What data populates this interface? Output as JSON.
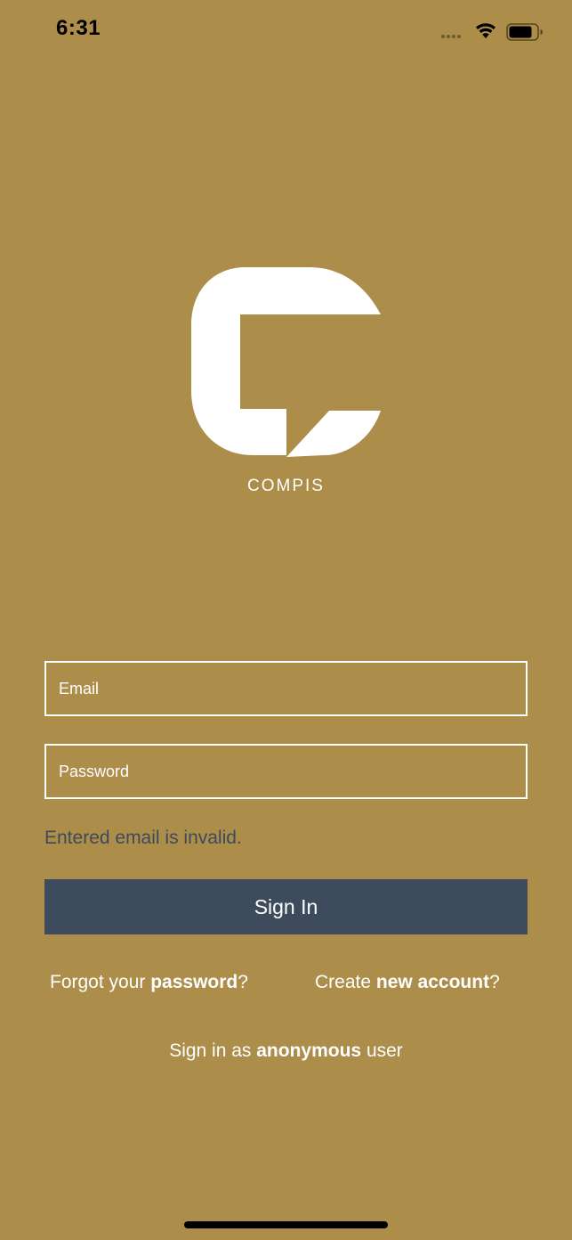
{
  "status_bar": {
    "time": "6:31",
    "icons": [
      "signal-dots-icon",
      "wifi-icon",
      "battery-icon"
    ]
  },
  "logo": {
    "icon": "compis-logo-icon",
    "brand_name": "COMPIS"
  },
  "form": {
    "email_placeholder": "Email",
    "email_value": "",
    "password_placeholder": "Password",
    "password_value": "",
    "error_message": "Entered email is invalid.",
    "signin_label": "Sign In"
  },
  "links": {
    "forgot_prefix": "Forgot your ",
    "forgot_bold": "password",
    "forgot_suffix": "?",
    "create_prefix": "Create ",
    "create_bold": "new account",
    "create_suffix": "?",
    "anon_prefix": "Sign in as ",
    "anon_bold": "anonymous",
    "anon_suffix": " user"
  },
  "colors": {
    "background": "#ad8d4a",
    "button": "#3d4b5c",
    "error_text": "#3d4a5c",
    "foreground": "#ffffff"
  }
}
